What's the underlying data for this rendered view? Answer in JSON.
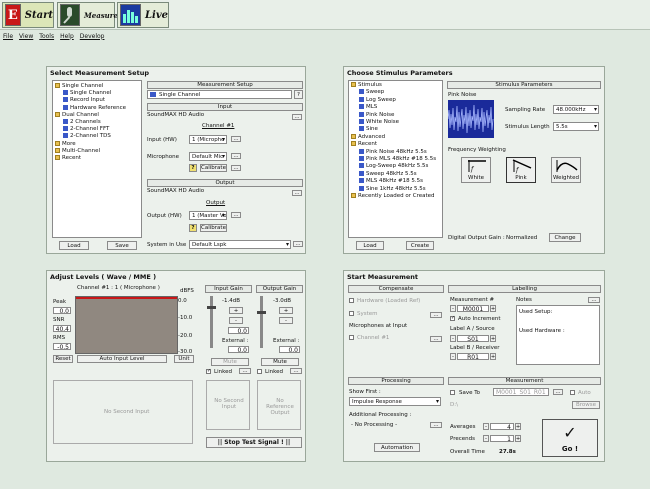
{
  "modes": {
    "start": "Start",
    "measure": "Measure",
    "live": "Live"
  },
  "menu": [
    "File",
    "View",
    "Tools",
    "Help",
    "Develop"
  ],
  "setup": {
    "title": "Select Measurement Setup",
    "tree": [
      {
        "label": "Single Channel",
        "kind": "folder"
      },
      {
        "label": "Single Channel",
        "kind": "item"
      },
      {
        "label": "Record Input",
        "kind": "item"
      },
      {
        "label": "Hardware Reference",
        "kind": "item"
      },
      {
        "label": "Dual Channel",
        "kind": "folder"
      },
      {
        "label": "2 Channels",
        "kind": "item"
      },
      {
        "label": "2-Channel FFT",
        "kind": "item"
      },
      {
        "label": "2-Channel TDS",
        "kind": "item"
      },
      {
        "label": "More",
        "kind": "folder"
      },
      {
        "label": "Multi-Channel",
        "kind": "folder"
      },
      {
        "label": "Recent",
        "kind": "folder"
      }
    ],
    "load": "Load",
    "save": "Save",
    "ms_header": "Measurement Setup",
    "ms_value": "Single Channel",
    "ms_help": "?",
    "input_header": "Input",
    "input_device": "SoundMAX HD Audio",
    "channel_label": "Channel #1",
    "input_hw_label": "Input (HW)",
    "input_hw_value": "1 (Micropho",
    "microphone_label": "Microphone",
    "microphone_value": "Default Mic",
    "calibrate": "Calibrate",
    "output_header": "Output",
    "output_device": "SoundMAX HD Audio",
    "output_label": "Output",
    "output_hw_label": "Output (HW)",
    "output_hw_value": "1 (Master Vo",
    "system_label": "System in Use",
    "system_value": "Default Lspk",
    "ellipsis": "...",
    "warn": "?"
  },
  "stimulus": {
    "title": "Choose Stimulus Parameters",
    "tree": [
      {
        "label": "Stimulus",
        "kind": "folder"
      },
      {
        "label": "Sweep",
        "kind": "item"
      },
      {
        "label": "Log Sweep",
        "kind": "item"
      },
      {
        "label": "MLS",
        "kind": "item"
      },
      {
        "label": "Pink Noise",
        "kind": "item"
      },
      {
        "label": "White Noise",
        "kind": "item"
      },
      {
        "label": "Sine",
        "kind": "item"
      },
      {
        "label": "Advanced",
        "kind": "folder"
      },
      {
        "label": "Recent",
        "kind": "folder"
      },
      {
        "label": "Pink Noise 48kHz 5.5s",
        "kind": "item"
      },
      {
        "label": "Pink MLS 48kHz #18 5.5s",
        "kind": "item"
      },
      {
        "label": "Log-Sweep 48kHz 5.5s",
        "kind": "item"
      },
      {
        "label": "Sweep 48kHz 5.5s",
        "kind": "item"
      },
      {
        "label": "MLS 48kHz #18 5.5s",
        "kind": "item"
      },
      {
        "label": "Sine 1kHz 48kHz 5.5s",
        "kind": "item"
      },
      {
        "label": "Recently Loaded or Created",
        "kind": "folder"
      }
    ],
    "load": "Load",
    "create": "Create",
    "params_header": "Stimulus Parameters",
    "name": "Pink Noise",
    "sampling_rate_label": "Sampling Rate",
    "sampling_rate": "48.000kHz",
    "stimulus_length_label": "Stimulus Length",
    "stimulus_length": "5.5s",
    "freq_weighting_label": "Frequency Weighting",
    "weights": [
      "White",
      "Pink",
      "Weighted"
    ],
    "digital_gain_label": "Digital Output Gain :",
    "digital_gain_value": "Normalized",
    "change": "Change"
  },
  "levels": {
    "title": "Adjust Levels ( Wave / MME )",
    "meter_title": "Channel #1 : 1 ( Microphone )",
    "unit_label": "dBFS",
    "scale": [
      "0.0",
      "-10.0",
      "-20.0",
      "-30.0"
    ],
    "peak_label": "Peak",
    "peak_value": "0.0",
    "snr_label": "SNR",
    "snr_value": "40.4",
    "rms_label": "RMS",
    "rms_value": "-0.5",
    "reset": "Reset",
    "auto": "Auto Input Level",
    "unit_button": "Unit",
    "no_second": "No Second Input",
    "input_gain": "Input Gain",
    "input_gain_value": "-1.4dB",
    "output_gain": "Output Gain",
    "output_gain_value": "-3.0dB",
    "plus": "+",
    "minus": "-",
    "gain_val": "0.0",
    "external_label": "External :",
    "external_in": "0.0",
    "external_out": "0.0",
    "mute": "Mute",
    "linked": "Linked",
    "no_second_input": "No Second Input",
    "no_ref_output": "No Reference Output",
    "stop_signal": "|| Stop Test Signal !  ||"
  },
  "start": {
    "title": "Start Measurement",
    "compensate": "Compensate",
    "hardware": "Hardware (Loaded Ref)",
    "system": "System",
    "mics_label": "Microphones at Input",
    "channel1": "Channel #1",
    "labelling": "Labelling",
    "measurement_no_label": "Measurement #",
    "measurement_no": "M0001",
    "notes_label": "Notes",
    "auto_increment": "Auto Increment",
    "label_a": "Label A / Source",
    "label_a_value": "S01",
    "label_b": "Label B / Receiver",
    "label_b_value": "R01",
    "notes_lines": [
      "Used Setup:",
      "Used Hardware :"
    ],
    "processing": "Processing",
    "show_first_label": "Show First :",
    "show_first_value": "Impulse Response",
    "additional_label": "Additional Processing :",
    "additional_value": "- No Processing -",
    "automation": "Automation",
    "measurement": "Measurement",
    "save_to": "Save To",
    "filename": "M0001_S01_R01",
    "auto_label": "Auto",
    "path": "D:\\",
    "browse": "Browse",
    "averages_label": "Averages",
    "averages_value": "4",
    "precends_label": "Precends",
    "precends_value": "1",
    "overall_label": "Overall Time",
    "overall_value": "27.8s",
    "go": "Go !"
  },
  "colors": {
    "accent": "#3a58c8",
    "meter": "#908880",
    "meter_line": "#c81818",
    "pink": "#c85a8a"
  }
}
